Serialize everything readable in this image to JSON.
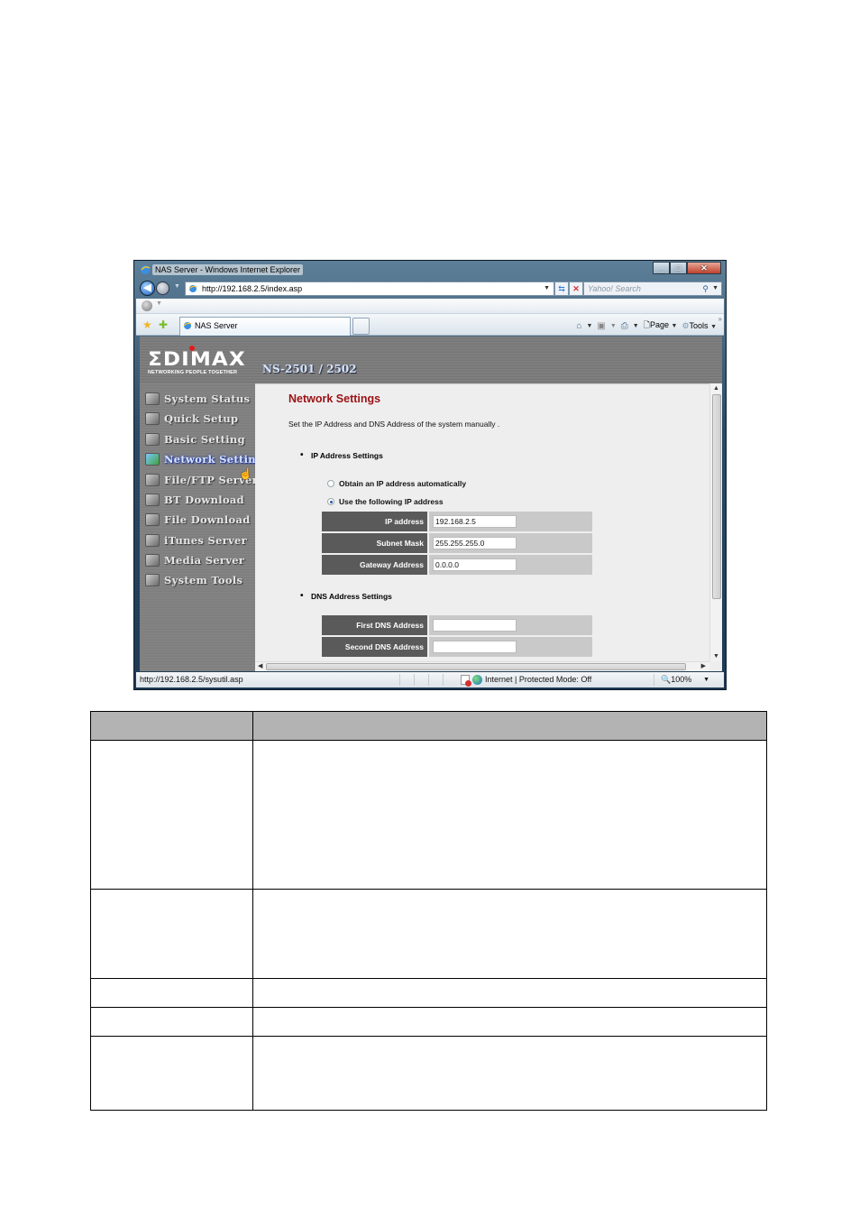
{
  "browser": {
    "window_title": "NAS Server - Windows Internet Explorer",
    "address": "http://192.168.2.5/index.asp",
    "search_placeholder": "Yahoo! Search",
    "tab_title": "NAS Server",
    "toolbar": {
      "page_label": "Page",
      "tools_label": "Tools"
    },
    "status": {
      "url": "http://192.168.2.5/sysutil.asp",
      "zone": "Internet | Protected Mode: Off",
      "zoom": "100%"
    }
  },
  "app": {
    "brand": "ΣDIMAX",
    "tagline": "NETWORKING PEOPLE TOGETHER",
    "model": "NS-2501 / 2502",
    "nav": [
      {
        "label": "System Status",
        "active": false
      },
      {
        "label": "Quick Setup",
        "active": false
      },
      {
        "label": "Basic Setting",
        "active": false
      },
      {
        "label": "Network Setting",
        "active": true
      },
      {
        "label": "File/FTP Server",
        "active": false
      },
      {
        "label": "BT Download",
        "active": false
      },
      {
        "label": "File Download",
        "active": false
      },
      {
        "label": "iTunes Server",
        "active": false
      },
      {
        "label": "Media Server",
        "active": false
      },
      {
        "label": "System Tools",
        "active": false
      }
    ],
    "page": {
      "title": "Network Settings",
      "description": "Set the IP Address and DNS Address of the system manually .",
      "ip_section": {
        "title": "IP Address Settings",
        "options": [
          {
            "label": "Obtain an IP address automatically",
            "checked": false
          },
          {
            "label": "Use the following IP address",
            "checked": true
          }
        ],
        "fields": [
          {
            "label": "IP address",
            "value": "192.168.2.5"
          },
          {
            "label": "Subnet Mask",
            "value": "255.255.255.0"
          },
          {
            "label": "Gateway Address",
            "value": "0.0.0.0"
          }
        ]
      },
      "dns_section": {
        "title": "DNS Address Settings",
        "fields": [
          {
            "label": "First DNS Address",
            "value": ""
          },
          {
            "label": "Second DNS Address",
            "value": ""
          }
        ]
      }
    }
  },
  "document_table": {
    "header": [
      "",
      ""
    ],
    "rows": [
      [
        "",
        ""
      ],
      [
        "",
        ""
      ],
      [
        "",
        ""
      ],
      [
        "",
        ""
      ],
      [
        "",
        ""
      ]
    ]
  }
}
